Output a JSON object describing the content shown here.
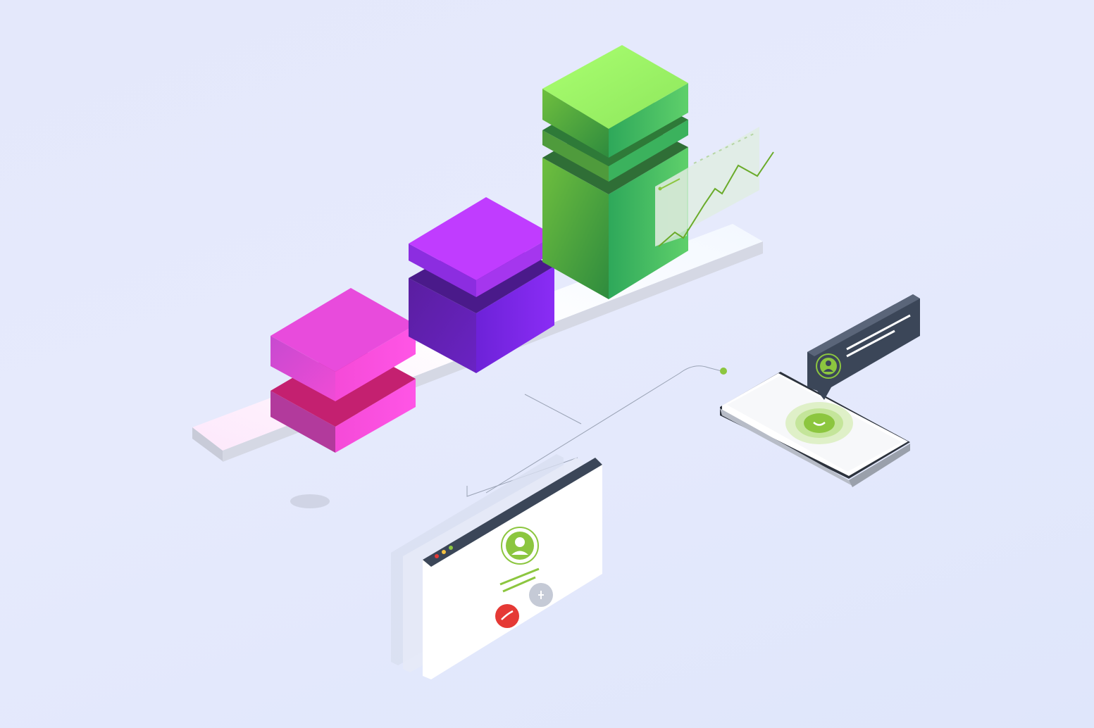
{
  "colors": {
    "background": "#e4e8fb",
    "pink": "#e040e6",
    "purple": "#9b2ff2",
    "green": "#6fd04f",
    "accent_green": "#8cc63f",
    "decline_red": "#e53935",
    "panel_dark": "#3b4658"
  },
  "scene": {
    "blocks": [
      "pink-block-stack",
      "purple-block-stack",
      "green-block-stack"
    ],
    "icons": [
      "trend-line-icon",
      "phone-answer-icon",
      "phone-decline-icon",
      "mute-mic-icon",
      "user-avatar-icon"
    ]
  }
}
